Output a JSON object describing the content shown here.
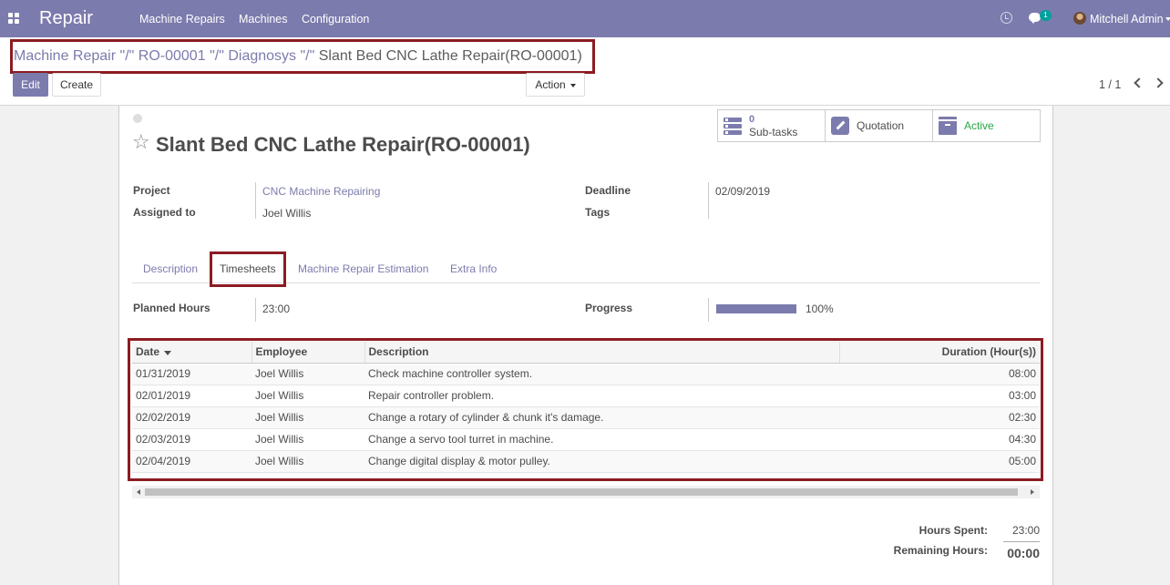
{
  "navbar": {
    "app_name": "Repair",
    "menu": [
      "Machine Repairs",
      "Machines",
      "Configuration"
    ],
    "chat_count": "1",
    "user_name": "Mitchell Admin"
  },
  "breadcrumb": {
    "items": [
      "Machine Repair",
      "RO-00001",
      "Diagnosys"
    ],
    "separator": "\"/\"",
    "current": "Slant Bed CNC Lathe Repair(RO-00001)"
  },
  "buttons": {
    "edit": "Edit",
    "create": "Create",
    "action": "Action"
  },
  "pager": "1 / 1",
  "smart_buttons": {
    "subtasks_count": "0",
    "subtasks_label": "Sub-tasks",
    "quotation": "Quotation",
    "active": "Active"
  },
  "record": {
    "title": "Slant Bed CNC Lathe Repair(RO-00001)",
    "project_label": "Project",
    "project": "CNC Machine Repairing",
    "assigned_label": "Assigned to",
    "assigned": "Joel Willis",
    "deadline_label": "Deadline",
    "deadline": "02/09/2019",
    "tags_label": "Tags",
    "tags": ""
  },
  "tabs": [
    "Description",
    "Timesheets",
    "Machine Repair Estimation",
    "Extra Info"
  ],
  "active_tab": "Timesheets",
  "timesheet": {
    "planned_label": "Planned Hours",
    "planned": "23:00",
    "progress_label": "Progress",
    "progress_value": 100,
    "progress_text": "100%",
    "columns": [
      "Date",
      "Employee",
      "Description",
      "Duration (Hour(s))"
    ],
    "rows": [
      [
        "01/31/2019",
        "Joel Willis",
        "Check machine controller system.",
        "08:00"
      ],
      [
        "02/01/2019",
        "Joel Willis",
        "Repair controller problem.",
        "03:00"
      ],
      [
        "02/02/2019",
        "Joel Willis",
        "Change a rotary of cylinder & chunk it's damage.",
        "02:30"
      ],
      [
        "02/03/2019",
        "Joel Willis",
        "Change a servo tool turret in machine.",
        "04:30"
      ],
      [
        "02/04/2019",
        "Joel Willis",
        "Change digital display & motor pulley.",
        "05:00"
      ]
    ]
  },
  "totals": {
    "spent_label": "Hours Spent:",
    "spent": "23:00",
    "remaining_label": "Remaining Hours:",
    "remaining": "00:00"
  },
  "colors": {
    "brand": "#7c7bad",
    "highlight": "#8b1c22",
    "active_green": "#28a745"
  }
}
